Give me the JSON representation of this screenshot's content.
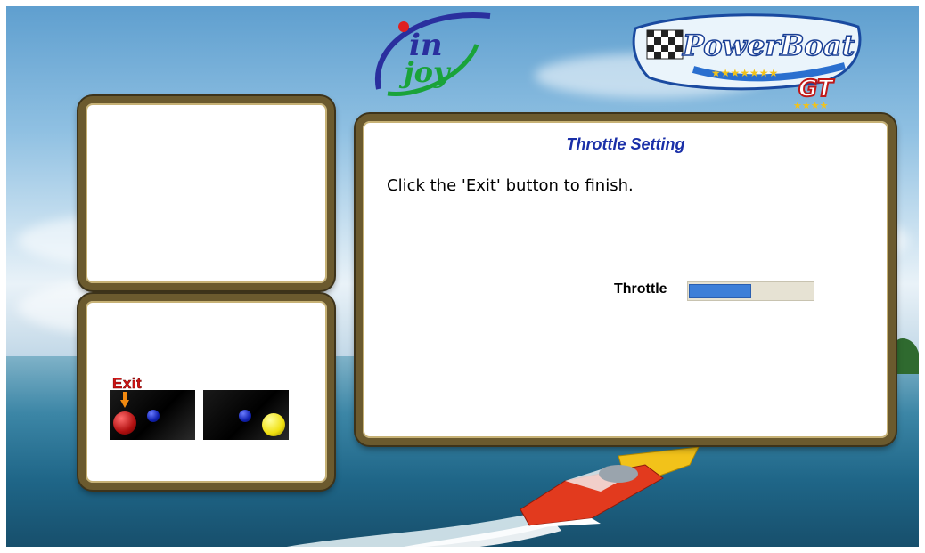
{
  "logos": {
    "injoy_text_top": "in",
    "injoy_text_bottom": "joy",
    "powerboat_text": "PowerBoat",
    "powerboat_sub": "GT"
  },
  "main_panel": {
    "title": "Throttle Setting",
    "instruction": "Click the 'Exit' button to finish.",
    "throttle_label": "Throttle",
    "throttle_level": 0.5
  },
  "controls_panel": {
    "exit_label": "Exit"
  },
  "colors": {
    "title": "#1a2fa8",
    "throttle_fill": "#3d7fd8",
    "exit_text": "#d41414",
    "panel_border": "#6b5a2e"
  }
}
